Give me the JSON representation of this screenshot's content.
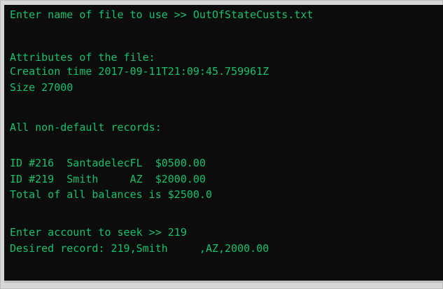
{
  "console": {
    "lines": [
      "Enter name of file to use >> OutOfStateCusts.txt",
      "Attributes of the file:",
      "Creation time 2017-09-11T21:09:45.759961Z",
      "Size 27000",
      "All non-default records:",
      "ID #216  SantadelecFL  $0500.00",
      "ID #219  Smith     AZ  $2000.00",
      "Total of all balances is $2500.0",
      "Enter account to seek >> 219",
      "Desired record: 219,Smith     ,AZ,2000.00"
    ],
    "text_color": "#13c26c",
    "background": "#0c0c0c"
  }
}
